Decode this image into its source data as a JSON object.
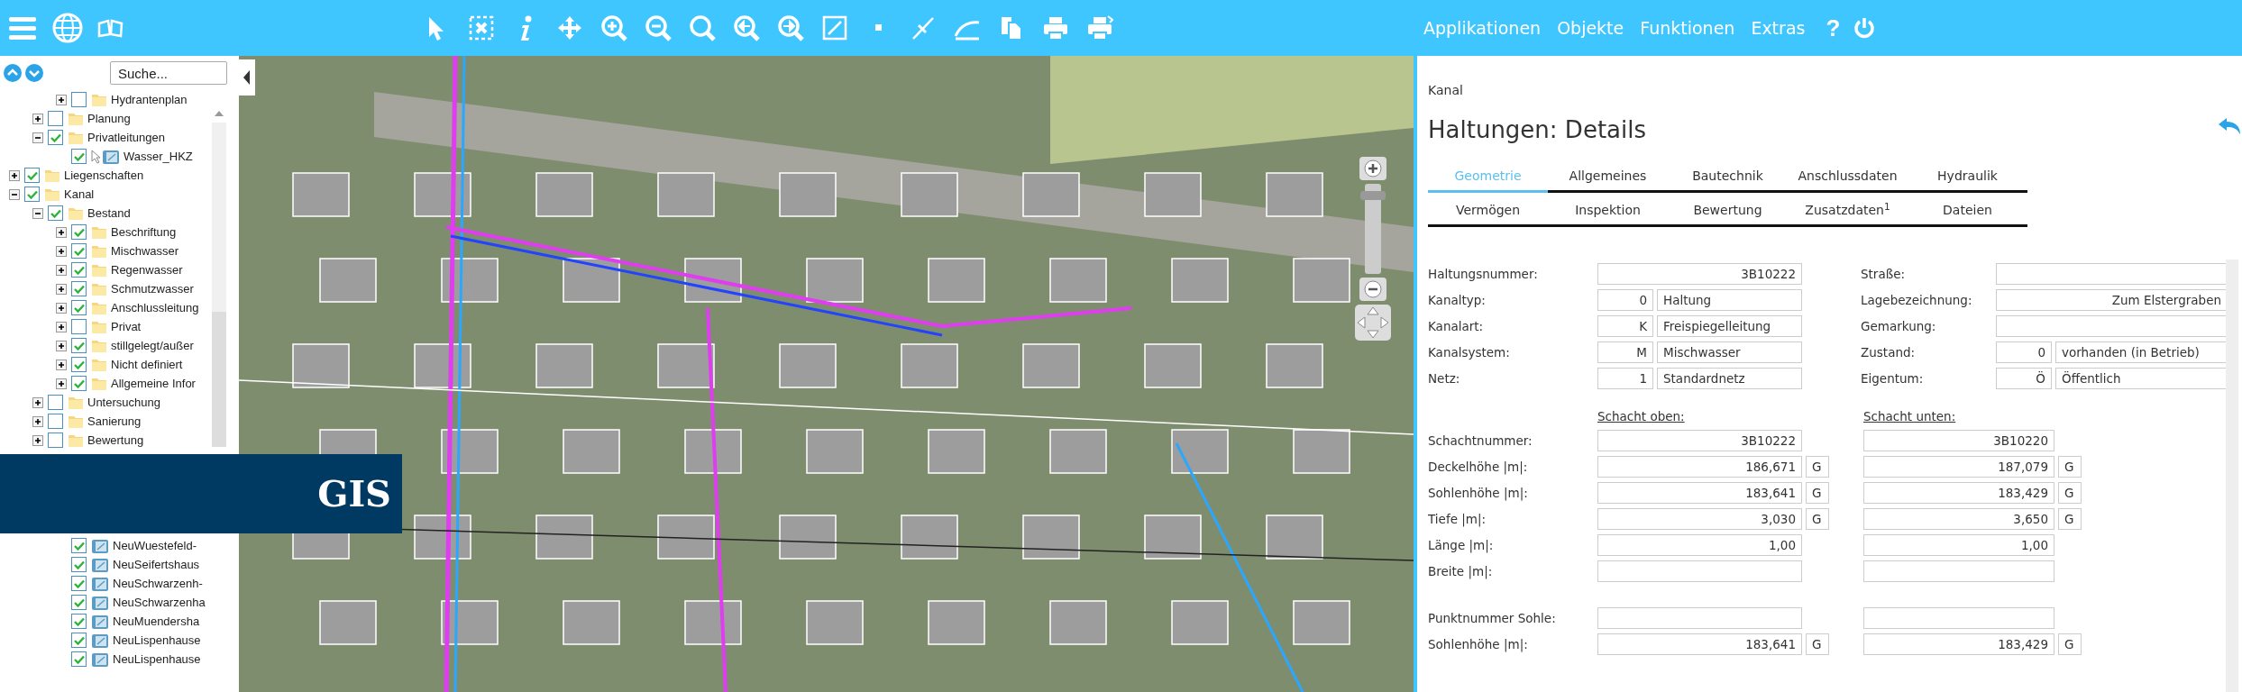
{
  "toolbar": {
    "menu": [
      {
        "label": "Applikationen"
      },
      {
        "label": "Objekte"
      },
      {
        "label": "Funktionen"
      },
      {
        "label": "Extras"
      }
    ],
    "help": "?"
  },
  "layer_panel": {
    "search": {
      "placeholder": "Suche..."
    },
    "tree": [
      {
        "children": [
          {
            "children": [
              {
                "label": "Hydrantenplan",
                "kind": "folder",
                "expanded": false,
                "checked": false
              }
            ]
          },
          {
            "label": "Planung",
            "kind": "folder",
            "expanded": false,
            "checked": false
          },
          {
            "label": "Privatleitungen",
            "kind": "folder",
            "expanded": true,
            "checked": true,
            "children": [
              {
                "label": "Wasser_HKZ",
                "kind": "layer",
                "checked": true,
                "pointer": true
              }
            ]
          }
        ]
      },
      {
        "label": "Liegenschaften",
        "kind": "folder",
        "expanded": false,
        "checked": true
      },
      {
        "label": "Kanal",
        "kind": "folder",
        "expanded": true,
        "checked": true,
        "children": [
          {
            "label": "Bestand",
            "kind": "folder",
            "expanded": true,
            "checked": true,
            "children": [
              {
                "label": "Beschriftung",
                "kind": "folder",
                "expanded": false,
                "checked": true
              },
              {
                "label": "Mischwasser",
                "kind": "folder",
                "expanded": false,
                "checked": true
              },
              {
                "label": "Regenwasser",
                "kind": "folder",
                "expanded": false,
                "checked": true
              },
              {
                "label": "Schmutzwasser",
                "kind": "folder",
                "expanded": false,
                "checked": true
              },
              {
                "label": "Anschlussleitung",
                "kind": "folder",
                "expanded": false,
                "checked": true
              },
              {
                "label": "Privat",
                "kind": "folder",
                "expanded": false,
                "checked": false
              },
              {
                "label": "stillgelegt/außer",
                "kind": "folder",
                "expanded": false,
                "checked": true
              },
              {
                "label": "Nicht definiert",
                "kind": "folder",
                "expanded": false,
                "checked": true
              },
              {
                "label": "Allgemeine Infor",
                "kind": "folder",
                "expanded": false,
                "checked": true
              }
            ]
          },
          {
            "label": "Untersuchung",
            "kind": "folder",
            "expanded": false,
            "checked": false
          },
          {
            "label": "Sanierung",
            "kind": "folder",
            "expanded": false,
            "checked": false
          },
          {
            "label": "Bewertung",
            "kind": "folder",
            "expanded": false,
            "checked": false
          },
          {
            "children": [
              {
                "label": "NeuWuestefeld-",
                "kind": "layer",
                "checked": true,
                "pointer": false
              },
              {
                "label": "NeuSeifertshaus",
                "kind": "layer",
                "checked": true,
                "pointer": false
              },
              {
                "label": "NeuSchwarzenh-",
                "kind": "layer",
                "checked": true,
                "pointer": false
              },
              {
                "label": "NeuSchwarzenha",
                "kind": "layer",
                "checked": true,
                "pointer": false
              },
              {
                "label": "NeuMuendersha",
                "kind": "layer",
                "checked": true,
                "pointer": false
              },
              {
                "label": "NeuLispenhause",
                "kind": "layer",
                "checked": true,
                "pointer": false
              },
              {
                "label": "NeuLispenhause",
                "kind": "layer",
                "checked": true,
                "pointer": false
              }
            ]
          }
        ]
      }
    ]
  },
  "banner": {
    "text": "GIS"
  },
  "details": {
    "breadcrumb": "Kanal",
    "title": "Haltungen: Details",
    "tab_rows": [
      [
        {
          "label": "Geometrie",
          "selected": true
        },
        {
          "label": "Allgemeines",
          "selected": false
        },
        {
          "label": "Bautechnik",
          "selected": false
        },
        {
          "label": "Anschlussdaten",
          "selected": false
        },
        {
          "label": "Hydraulik",
          "selected": false
        }
      ],
      [
        {
          "label": "Vermögen",
          "selected": false
        },
        {
          "label": "Inspektion",
          "selected": false
        },
        {
          "label": "Bewertung",
          "selected": false
        },
        {
          "label": "Zusatzdaten$^{1}$",
          "selected": false
        },
        {
          "label": "Dateien",
          "selected": false
        }
      ]
    ],
    "general": [
      {
        "left": {
          "label": "Haltungsnummer:",
          "kind": "single",
          "value": "3B10222"
        },
        "right": {
          "label": "Straße:",
          "kind": "single"
        }
      },
      {
        "left": {
          "label": "Kanaltyp:",
          "kind": "pair",
          "code": "0",
          "value": "Haltung"
        },
        "right": {
          "label": "Lagebezeichnung:",
          "kind": "single",
          "value": "Zum Elstergraben"
        }
      },
      {
        "left": {
          "label": "Kanalart:",
          "kind": "pair",
          "code": "K",
          "value": "Freispiegelleitung"
        },
        "right": {
          "label": "Gemarkung:",
          "kind": "single"
        }
      },
      {
        "left": {
          "label": "Kanalsystem:",
          "kind": "pair",
          "code": "M",
          "value": "Mischwasser"
        },
        "right": {
          "label": "Zustand:",
          "kind": "pair",
          "code": "0",
          "value": "vorhanden (in Betrieb)"
        }
      },
      {
        "left": {
          "label": "Netz:",
          "kind": "pair",
          "code": "1",
          "value": "Standardnetz"
        },
        "right": {
          "label": "Eigentum:",
          "kind": "pair",
          "code": "Ö",
          "value": "Öffentlich"
        }
      }
    ],
    "shaft_headers": [
      "Schacht oben:",
      "Schacht unten:"
    ],
    "shaft_rows": [
      {
        "label": "Schachtnummer:",
        "top": {
          "value": "3B10222"
        },
        "bottom": {
          "value": "3B10220"
        }
      },
      {
        "label": "Deckelhöhe |m|:",
        "top": {
          "value": "186,671",
          "flag": "G"
        },
        "bottom": {
          "value": "187,079",
          "flag": "G"
        }
      },
      {
        "label": "Sohlenhöhe |m|:",
        "top": {
          "value": "183,641",
          "flag": "G"
        },
        "bottom": {
          "value": "183,429",
          "flag": "G"
        }
      },
      {
        "label": "Tiefe |m|:",
        "top": {
          "value": "3,030",
          "flag": "G"
        },
        "bottom": {
          "value": "3,650",
          "flag": "G"
        }
      },
      {
        "label": "Länge |m|:",
        "top": {
          "value": "1,00"
        },
        "bottom": {
          "value": "1,00"
        }
      },
      {
        "label": "Breite |m|:",
        "top": {},
        "bottom": {}
      }
    ],
    "sole_rows": [
      {
        "label": "Punktnummer Sohle:",
        "top": {},
        "bottom": {}
      },
      {
        "label": "Sohlenhöhe |m|:",
        "top": {
          "value": "183,641",
          "flag": "G"
        },
        "bottom": {
          "value": "183,429",
          "flag": "G"
        }
      }
    ]
  }
}
